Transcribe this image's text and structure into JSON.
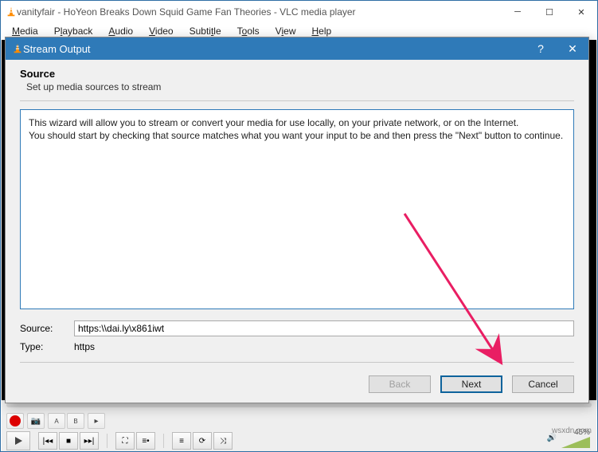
{
  "main_window": {
    "title": "vanityfair - HoYeon Breaks Down Squid Game Fan Theories - VLC media player",
    "menubar": [
      "Media",
      "Playback",
      "Audio",
      "Video",
      "Subtitle",
      "Tools",
      "View",
      "Help"
    ]
  },
  "dialog": {
    "title": "Stream Output",
    "heading": "Source",
    "subheading": "Set up media sources to stream",
    "wizard_text_line1": "This wizard will allow you to stream or convert your media for use locally, on your private network, or on the Internet.",
    "wizard_text_line2": "You should start by checking that source matches what you want your input to be and then press the \"Next\" button to continue.",
    "source_label": "Source:",
    "source_value": "https:\\\\dai.ly\\x861iwt",
    "type_label": "Type:",
    "type_value": "https",
    "buttons": {
      "back": "Back",
      "next": "Next",
      "cancel": "Cancel"
    }
  },
  "footer": {
    "volume_pct": "45%",
    "watermark": "wsxdn.com"
  }
}
